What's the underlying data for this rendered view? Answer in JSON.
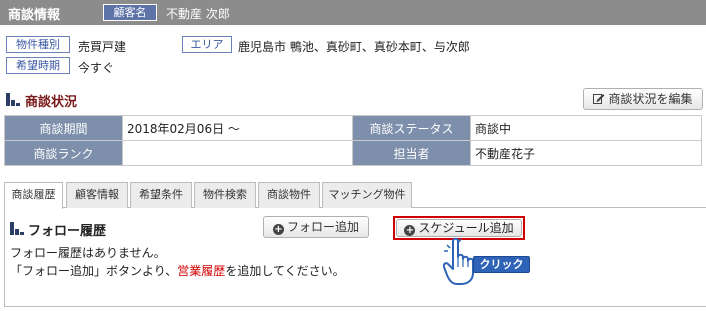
{
  "header": {
    "title": "商談情報",
    "customer_tag": "顧客名",
    "customer_name": "不動産 次郎"
  },
  "info": {
    "property_type_label": "物件種別",
    "property_type_value": "売買戸建",
    "area_label": "エリア",
    "area_value": "鹿児島市 鴨池、真砂町、真砂本町、与次郎",
    "timing_label": "希望時期",
    "timing_value": "今すぐ"
  },
  "status_section": {
    "title": "商談状況",
    "edit_button": "商談状況を編集"
  },
  "status_table": {
    "period_label": "商談期間",
    "period_value": "2018年02月06日 ～",
    "status_label": "商談ステータス",
    "status_value": "商談中",
    "rank_label": "商談ランク",
    "rank_value": "",
    "staff_label": "担当者",
    "staff_value": "不動産花子"
  },
  "tabs": [
    {
      "label": "商談履歴",
      "active": true
    },
    {
      "label": "顧客情報",
      "active": false
    },
    {
      "label": "希望条件",
      "active": false
    },
    {
      "label": "物件検索",
      "active": false
    },
    {
      "label": "商談物件",
      "active": false
    },
    {
      "label": "マッチング物件",
      "active": false
    }
  ],
  "follow_section": {
    "title": "フォロー履歴",
    "add_follow_button": "フォロー追加",
    "add_schedule_button": "スケジュール追加",
    "empty_message": "フォロー履歴はありません。",
    "hint_prefix": "「フォロー追加」ボタンより、",
    "hint_highlight": "営業履歴",
    "hint_suffix": "を追加してください。"
  },
  "annotation": {
    "click_label": "クリック"
  },
  "colors": {
    "header_bg": "#8c8c8c",
    "table_header_bg": "#7d8fab",
    "highlight_red": "#d00000",
    "click_badge": "#2f63b8"
  },
  "icons": {
    "section": "bar-chart-icon",
    "edit": "edit-icon",
    "add": "plus-circle-icon",
    "pointer": "hand-pointer-icon"
  }
}
